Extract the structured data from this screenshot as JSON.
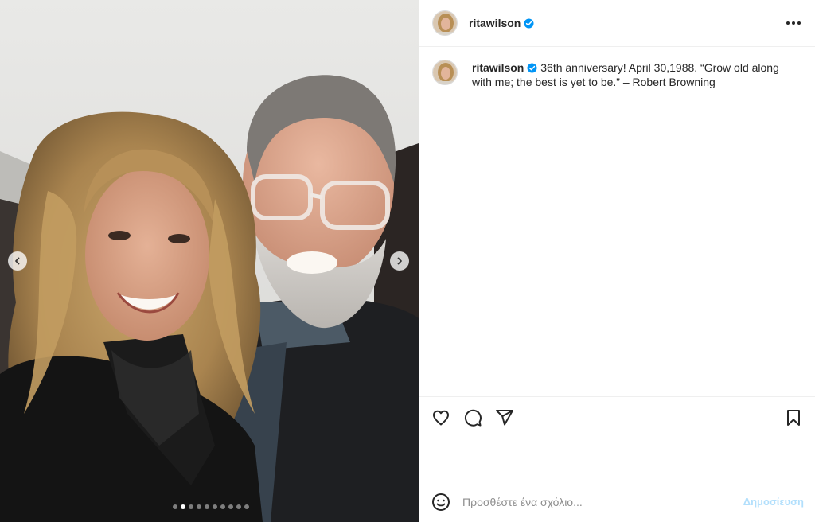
{
  "post": {
    "username": "ritawilson",
    "verified": true,
    "caption": "36th anniversary! April 30,1988. “Grow old along with me; the best is yet to be.” – Robert Browning"
  },
  "media": {
    "slide_count": 10,
    "active_slide": 2
  },
  "actions": {
    "like_icon": "heart-icon",
    "comment_icon": "comment-icon",
    "share_icon": "share-icon",
    "save_icon": "bookmark-icon"
  },
  "comment": {
    "placeholder": "Προσθέστε ένα σχόλιο...",
    "post_label": "Δημοσίευση"
  },
  "colors": {
    "verified_blue": "#0095f6",
    "post_button_disabled": "#b2dffc",
    "border": "#efefef"
  }
}
